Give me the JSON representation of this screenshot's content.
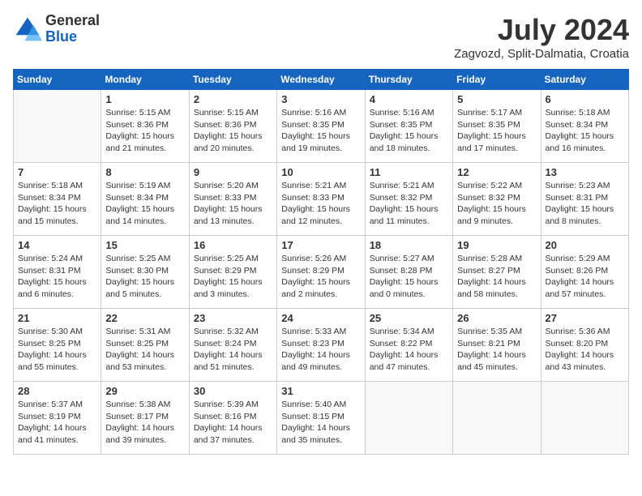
{
  "header": {
    "logo_general": "General",
    "logo_blue": "Blue",
    "month_title": "July 2024",
    "location": "Zagvozd, Split-Dalmatia, Croatia"
  },
  "calendar": {
    "days_of_week": [
      "Sunday",
      "Monday",
      "Tuesday",
      "Wednesday",
      "Thursday",
      "Friday",
      "Saturday"
    ],
    "weeks": [
      [
        {
          "day": "",
          "info": ""
        },
        {
          "day": "1",
          "info": "Sunrise: 5:15 AM\nSunset: 8:36 PM\nDaylight: 15 hours\nand 21 minutes."
        },
        {
          "day": "2",
          "info": "Sunrise: 5:15 AM\nSunset: 8:36 PM\nDaylight: 15 hours\nand 20 minutes."
        },
        {
          "day": "3",
          "info": "Sunrise: 5:16 AM\nSunset: 8:35 PM\nDaylight: 15 hours\nand 19 minutes."
        },
        {
          "day": "4",
          "info": "Sunrise: 5:16 AM\nSunset: 8:35 PM\nDaylight: 15 hours\nand 18 minutes."
        },
        {
          "day": "5",
          "info": "Sunrise: 5:17 AM\nSunset: 8:35 PM\nDaylight: 15 hours\nand 17 minutes."
        },
        {
          "day": "6",
          "info": "Sunrise: 5:18 AM\nSunset: 8:34 PM\nDaylight: 15 hours\nand 16 minutes."
        }
      ],
      [
        {
          "day": "7",
          "info": "Sunrise: 5:18 AM\nSunset: 8:34 PM\nDaylight: 15 hours\nand 15 minutes."
        },
        {
          "day": "8",
          "info": "Sunrise: 5:19 AM\nSunset: 8:34 PM\nDaylight: 15 hours\nand 14 minutes."
        },
        {
          "day": "9",
          "info": "Sunrise: 5:20 AM\nSunset: 8:33 PM\nDaylight: 15 hours\nand 13 minutes."
        },
        {
          "day": "10",
          "info": "Sunrise: 5:21 AM\nSunset: 8:33 PM\nDaylight: 15 hours\nand 12 minutes."
        },
        {
          "day": "11",
          "info": "Sunrise: 5:21 AM\nSunset: 8:32 PM\nDaylight: 15 hours\nand 11 minutes."
        },
        {
          "day": "12",
          "info": "Sunrise: 5:22 AM\nSunset: 8:32 PM\nDaylight: 15 hours\nand 9 minutes."
        },
        {
          "day": "13",
          "info": "Sunrise: 5:23 AM\nSunset: 8:31 PM\nDaylight: 15 hours\nand 8 minutes."
        }
      ],
      [
        {
          "day": "14",
          "info": "Sunrise: 5:24 AM\nSunset: 8:31 PM\nDaylight: 15 hours\nand 6 minutes."
        },
        {
          "day": "15",
          "info": "Sunrise: 5:25 AM\nSunset: 8:30 PM\nDaylight: 15 hours\nand 5 minutes."
        },
        {
          "day": "16",
          "info": "Sunrise: 5:25 AM\nSunset: 8:29 PM\nDaylight: 15 hours\nand 3 minutes."
        },
        {
          "day": "17",
          "info": "Sunrise: 5:26 AM\nSunset: 8:29 PM\nDaylight: 15 hours\nand 2 minutes."
        },
        {
          "day": "18",
          "info": "Sunrise: 5:27 AM\nSunset: 8:28 PM\nDaylight: 15 hours\nand 0 minutes."
        },
        {
          "day": "19",
          "info": "Sunrise: 5:28 AM\nSunset: 8:27 PM\nDaylight: 14 hours\nand 58 minutes."
        },
        {
          "day": "20",
          "info": "Sunrise: 5:29 AM\nSunset: 8:26 PM\nDaylight: 14 hours\nand 57 minutes."
        }
      ],
      [
        {
          "day": "21",
          "info": "Sunrise: 5:30 AM\nSunset: 8:25 PM\nDaylight: 14 hours\nand 55 minutes."
        },
        {
          "day": "22",
          "info": "Sunrise: 5:31 AM\nSunset: 8:25 PM\nDaylight: 14 hours\nand 53 minutes."
        },
        {
          "day": "23",
          "info": "Sunrise: 5:32 AM\nSunset: 8:24 PM\nDaylight: 14 hours\nand 51 minutes."
        },
        {
          "day": "24",
          "info": "Sunrise: 5:33 AM\nSunset: 8:23 PM\nDaylight: 14 hours\nand 49 minutes."
        },
        {
          "day": "25",
          "info": "Sunrise: 5:34 AM\nSunset: 8:22 PM\nDaylight: 14 hours\nand 47 minutes."
        },
        {
          "day": "26",
          "info": "Sunrise: 5:35 AM\nSunset: 8:21 PM\nDaylight: 14 hours\nand 45 minutes."
        },
        {
          "day": "27",
          "info": "Sunrise: 5:36 AM\nSunset: 8:20 PM\nDaylight: 14 hours\nand 43 minutes."
        }
      ],
      [
        {
          "day": "28",
          "info": "Sunrise: 5:37 AM\nSunset: 8:19 PM\nDaylight: 14 hours\nand 41 minutes."
        },
        {
          "day": "29",
          "info": "Sunrise: 5:38 AM\nSunset: 8:17 PM\nDaylight: 14 hours\nand 39 minutes."
        },
        {
          "day": "30",
          "info": "Sunrise: 5:39 AM\nSunset: 8:16 PM\nDaylight: 14 hours\nand 37 minutes."
        },
        {
          "day": "31",
          "info": "Sunrise: 5:40 AM\nSunset: 8:15 PM\nDaylight: 14 hours\nand 35 minutes."
        },
        {
          "day": "",
          "info": ""
        },
        {
          "day": "",
          "info": ""
        },
        {
          "day": "",
          "info": ""
        }
      ]
    ]
  }
}
